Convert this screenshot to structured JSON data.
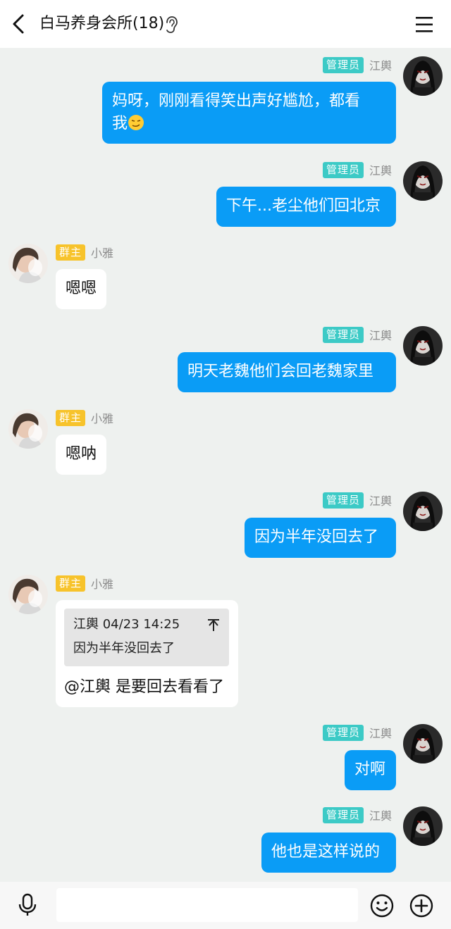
{
  "header": {
    "title": "白马养身会所(18)"
  },
  "icons": {
    "back": "chevron-left-icon",
    "listen": "ear-icon",
    "menu": "hamburger-menu-icon",
    "mic": "microphone-icon",
    "emoji": "smiley-icon",
    "plus": "plus-circle-icon"
  },
  "colors": {
    "outgoing_bubble": "#0a9cf6",
    "admin_badge": "#3ccac6",
    "owner_badge": "#f7c32b",
    "background": "#eef1ef"
  },
  "messages": [
    {
      "side": "right",
      "badge": "管理员",
      "sender": "江輿",
      "text": "妈呀，刚刚看得笑出声好尴尬，都看",
      "text2": "我"
    },
    {
      "side": "right",
      "badge": "管理员",
      "sender": "江輿",
      "text": "下午...老尘他们回北京"
    },
    {
      "side": "left",
      "badge": "群主",
      "sender": "小雅",
      "text": "嗯嗯"
    },
    {
      "side": "right",
      "badge": "管理员",
      "sender": "江輿",
      "text": "明天老魏他们会回老魏家里"
    },
    {
      "side": "left",
      "badge": "群主",
      "sender": "小雅",
      "text": "嗯呐"
    },
    {
      "side": "right",
      "badge": "管理员",
      "sender": "江輿",
      "text": "因为半年没回去了"
    },
    {
      "side": "left",
      "badge": "群主",
      "sender": "小雅",
      "text": "@江輿 是要回去看看了",
      "quote": {
        "header": "江輿 04/23 14:25",
        "text": "因为半年没回去了"
      }
    },
    {
      "side": "right",
      "badge": "管理员",
      "sender": "江輿",
      "text": "对啊"
    },
    {
      "side": "right",
      "badge": "管理员",
      "sender": "江輿",
      "text": "他也是这样说的"
    }
  ],
  "input": {
    "value": "",
    "placeholder": ""
  }
}
